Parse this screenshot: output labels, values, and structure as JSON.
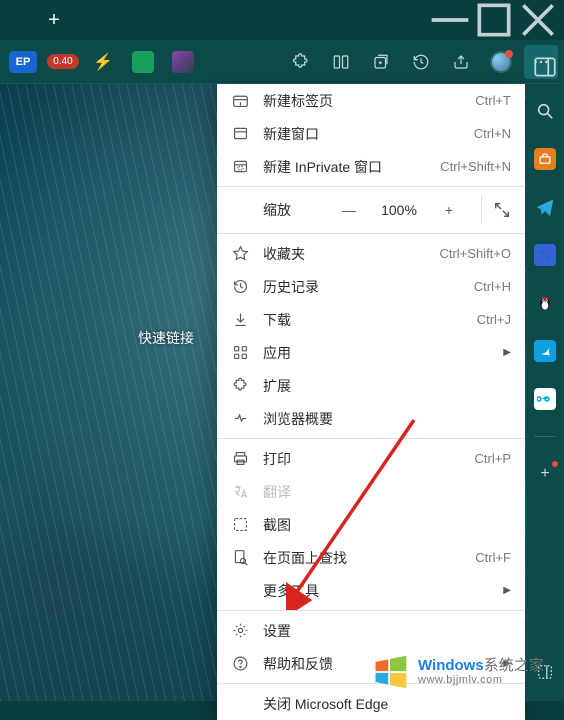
{
  "window": {
    "new_tab_glyph": "+"
  },
  "toolbar": {
    "ep_label": "EP",
    "badge": "0.40"
  },
  "content": {
    "quick_links": "快速链接"
  },
  "menu": {
    "new_tab": {
      "label": "新建标签页",
      "shortcut": "Ctrl+T"
    },
    "new_window": {
      "label": "新建窗口",
      "shortcut": "Ctrl+N"
    },
    "new_inprivate": {
      "label": "新建 InPrivate 窗口",
      "shortcut": "Ctrl+Shift+N"
    },
    "zoom": {
      "label": "缩放",
      "minus": "—",
      "value": "100%",
      "plus": "+"
    },
    "favorites": {
      "label": "收藏夹",
      "shortcut": "Ctrl+Shift+O"
    },
    "history": {
      "label": "历史记录",
      "shortcut": "Ctrl+H"
    },
    "downloads": {
      "label": "下载",
      "shortcut": "Ctrl+J"
    },
    "apps": {
      "label": "应用"
    },
    "extensions": {
      "label": "扩展"
    },
    "browser_overview": {
      "label": "浏览器概要"
    },
    "print": {
      "label": "打印",
      "shortcut": "Ctrl+P"
    },
    "translate": {
      "label": "翻译"
    },
    "screenshot": {
      "label": "截图"
    },
    "find": {
      "label": "在页面上查找",
      "shortcut": "Ctrl+F"
    },
    "more_tools": {
      "label": "更多工具"
    },
    "settings": {
      "label": "设置"
    },
    "help": {
      "label": "帮助和反馈"
    },
    "close_edge": {
      "label": "关闭 Microsoft Edge"
    },
    "submenu_arrow": "▶"
  },
  "watermark": {
    "brand_blue": "Windows",
    "brand_grey": "系统之家",
    "url": "www.bjjmlv.com"
  }
}
